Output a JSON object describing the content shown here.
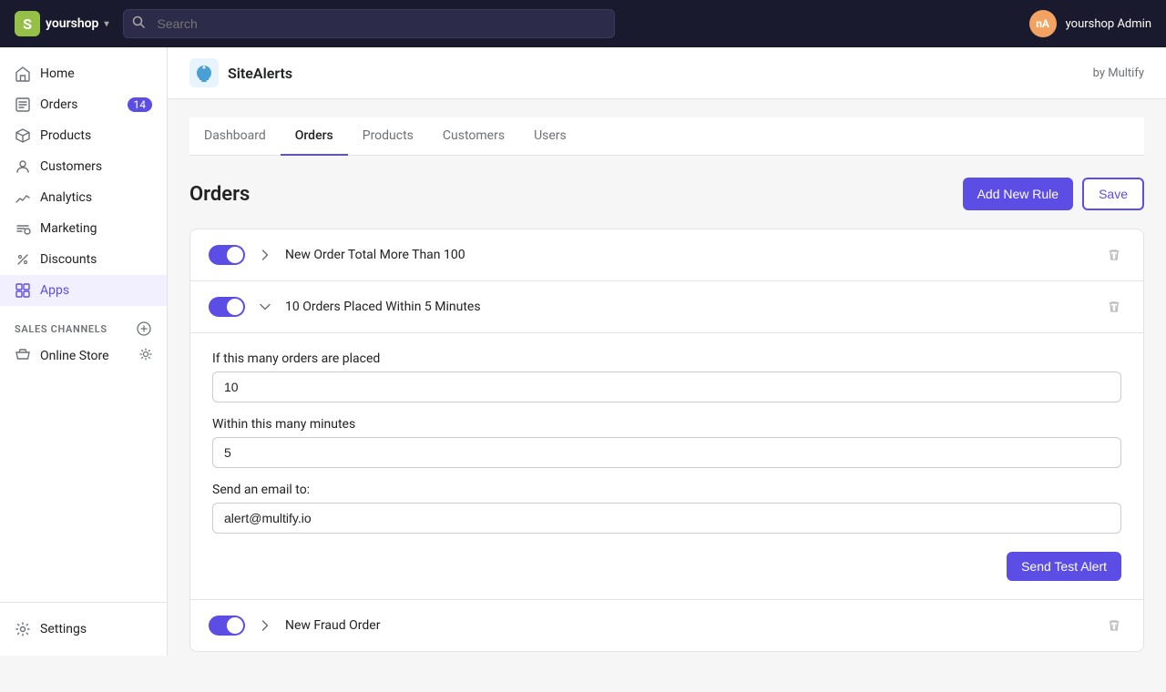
{
  "topnav": {
    "brand": "yourshop",
    "search_placeholder": "Search",
    "user_initials": "nA",
    "user_name": "yourshop Admin"
  },
  "sidebar": {
    "items": [
      {
        "id": "home",
        "label": "Home",
        "icon": "home",
        "badge": null,
        "active": false
      },
      {
        "id": "orders",
        "label": "Orders",
        "icon": "orders",
        "badge": "14",
        "active": false
      },
      {
        "id": "products",
        "label": "Products",
        "icon": "products",
        "badge": null,
        "active": false
      },
      {
        "id": "customers",
        "label": "Customers",
        "icon": "customers",
        "badge": null,
        "active": false
      },
      {
        "id": "analytics",
        "label": "Analytics",
        "icon": "analytics",
        "badge": null,
        "active": false
      },
      {
        "id": "marketing",
        "label": "Marketing",
        "icon": "marketing",
        "badge": null,
        "active": false
      },
      {
        "id": "discounts",
        "label": "Discounts",
        "icon": "discounts",
        "badge": null,
        "active": false
      },
      {
        "id": "apps",
        "label": "Apps",
        "icon": "apps",
        "badge": null,
        "active": true
      }
    ],
    "channels_section": "SALES CHANNELS",
    "channels": [
      {
        "id": "online-store",
        "label": "Online Store"
      }
    ],
    "footer": {
      "settings_label": "Settings"
    }
  },
  "app": {
    "name": "SiteAlerts",
    "by": "by Multify"
  },
  "tabs": [
    {
      "id": "dashboard",
      "label": "Dashboard",
      "active": false
    },
    {
      "id": "orders",
      "label": "Orders",
      "active": true
    },
    {
      "id": "products",
      "label": "Products",
      "active": false
    },
    {
      "id": "customers",
      "label": "Customers",
      "active": false
    },
    {
      "id": "users",
      "label": "Users",
      "active": false
    }
  ],
  "orders_page": {
    "title": "Orders",
    "add_new_rule": "Add New Rule",
    "save": "Save"
  },
  "rules": [
    {
      "id": "rule1",
      "label": "New Order Total More Than 100",
      "enabled": true,
      "expanded": false
    },
    {
      "id": "rule2",
      "label": "10 Orders Placed Within 5 Minutes",
      "enabled": true,
      "expanded": true,
      "fields": {
        "orders_label": "If this many orders are placed",
        "orders_value": "10",
        "minutes_label": "Within this many minutes",
        "minutes_value": "5",
        "email_label": "Send an email to:",
        "email_value": "alert@multify.io"
      },
      "send_test_label": "Send Test Alert"
    },
    {
      "id": "rule3",
      "label": "New Fraud Order",
      "enabled": true,
      "expanded": false
    }
  ]
}
